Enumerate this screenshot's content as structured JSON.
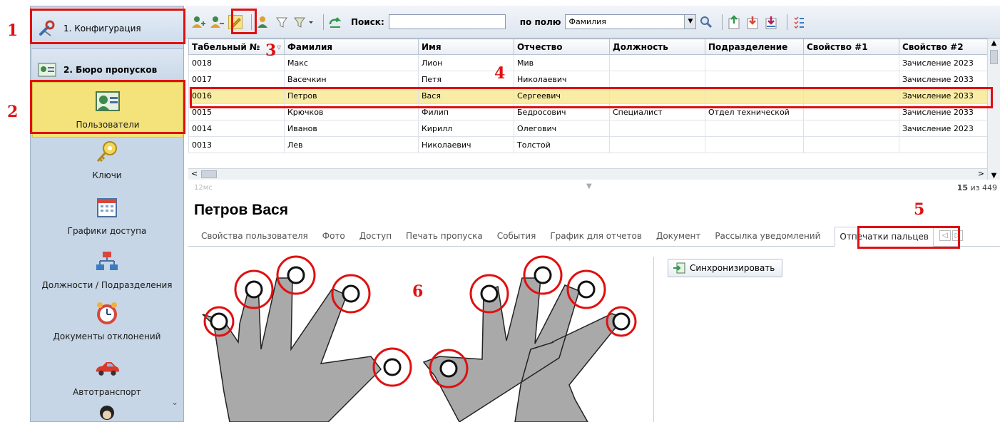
{
  "annotations": [
    "1",
    "2",
    "3",
    "4",
    "5",
    "6"
  ],
  "sidebar": {
    "section1": "1. Конфигурация",
    "section2": "2. Бюро пропусков",
    "items": [
      {
        "label": "Пользователи",
        "icon": "users-icon"
      },
      {
        "label": "Ключи",
        "icon": "key-icon"
      },
      {
        "label": "Графики доступа",
        "icon": "calendar-icon"
      },
      {
        "label": "Должности / Подразделения",
        "icon": "org-chart-icon"
      },
      {
        "label": "Документы отклонений",
        "icon": "alarm-clock-icon"
      },
      {
        "label": "Автотранспорт",
        "icon": "car-icon"
      }
    ]
  },
  "toolbar": {
    "search_label": "Поиск:",
    "search_value": "",
    "field_label": "по полю",
    "field_value": "Фамилия"
  },
  "table": {
    "columns": [
      "Табельный №",
      "Фамилия",
      "Имя",
      "Отчество",
      "Должность",
      "Подразделение",
      "Свойство #1",
      "Свойство #2"
    ],
    "rows": [
      [
        "0018",
        "Макс",
        "Лион",
        "Мив",
        "",
        "",
        "",
        "Зачисление 2023"
      ],
      [
        "0017",
        "Васечкин",
        "Петя",
        "Николаевич",
        "",
        "",
        "",
        "Зачисление 2033"
      ],
      [
        "0016",
        "Петров",
        "Вася",
        "Сергеевич",
        "",
        "",
        "",
        "Зачисление 2033"
      ],
      [
        "0015",
        "Крючков",
        "Филип",
        "Бедросович",
        "Специалист",
        "Отдел технической",
        "",
        "Зачисление 2033"
      ],
      [
        "0014",
        "Иванов",
        "Кирилл",
        "Олегович",
        "",
        "",
        "",
        "Зачисление 2023"
      ],
      [
        "0013",
        "Лев",
        "Николаевич",
        "Толстой",
        "",
        "",
        "",
        ""
      ]
    ],
    "selected_row": 2
  },
  "status": {
    "time": "12мс",
    "count_bold": "15",
    "count_rest": " из 449"
  },
  "person_name": "Петров Вася",
  "tabs": [
    "Свойства пользователя",
    "Фото",
    "Доступ",
    "Печать пропуска",
    "События",
    "График для отчетов",
    "Документ",
    "Рассылка уведомлений",
    "Отпечатки пальцев"
  ],
  "active_tab": 8,
  "sync_button": "Синхронизировать",
  "colors": {
    "annotation": "#e01010",
    "selected_row": "#f9eca4",
    "hand": "#a8a8a8"
  }
}
